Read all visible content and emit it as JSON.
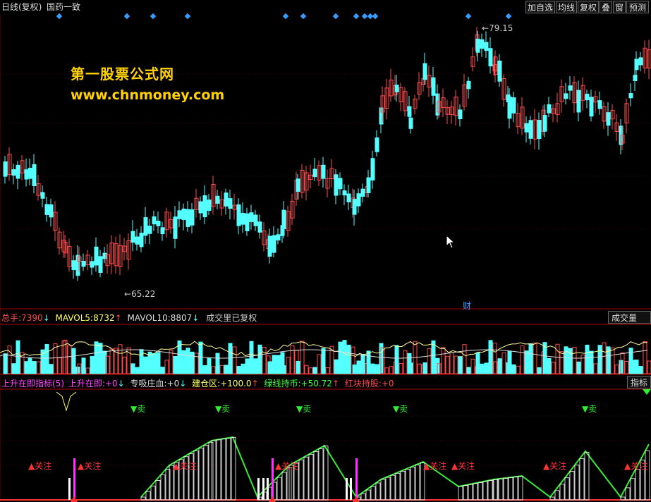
{
  "header": {
    "period": "日线(复权)",
    "stock_name": "国药一致",
    "buttons": [
      "加自选",
      "均线",
      "复权",
      "叠",
      "窗",
      "预测"
    ]
  },
  "watermark": {
    "line1": "第一股票公式网",
    "line2": "www.chnmoney.com"
  },
  "price_panel": {
    "high_label": "79.15",
    "low_label": "65.22",
    "marker": "财",
    "colors": {
      "up": "#ff4b4b",
      "down": "#54ffff",
      "grid": "#7a0000",
      "diamond": "#3a9bff"
    }
  },
  "volume_panel": {
    "labels": [
      {
        "name": "总手:",
        "value": "7390",
        "arrow": "↓"
      },
      {
        "name": "MAVOL5:",
        "value": "8732",
        "arrow": "↑"
      },
      {
        "name": "MAVOL10:",
        "value": "8807",
        "arrow": "↓"
      }
    ],
    "note": "成交里已复权",
    "right_button": "成交量"
  },
  "indicator_panel": {
    "title": "上升在即指标(5)",
    "labels": [
      {
        "name": "上升在即:",
        "value": "+0",
        "arrow": "↓"
      },
      {
        "name": "专吸庄血:",
        "value": "+0",
        "arrow": "↓"
      },
      {
        "name": "建仓区:",
        "value": "+100.0",
        "arrow": "↑"
      },
      {
        "name": "绿线持币:",
        "value": "+50.72",
        "arrow": "↑"
      },
      {
        "name": "红块持股:",
        "value": "+0",
        "arrow": ""
      }
    ],
    "right_button": "指标",
    "sell_label": "▼卖",
    "watch_label": "▲关注"
  }
}
